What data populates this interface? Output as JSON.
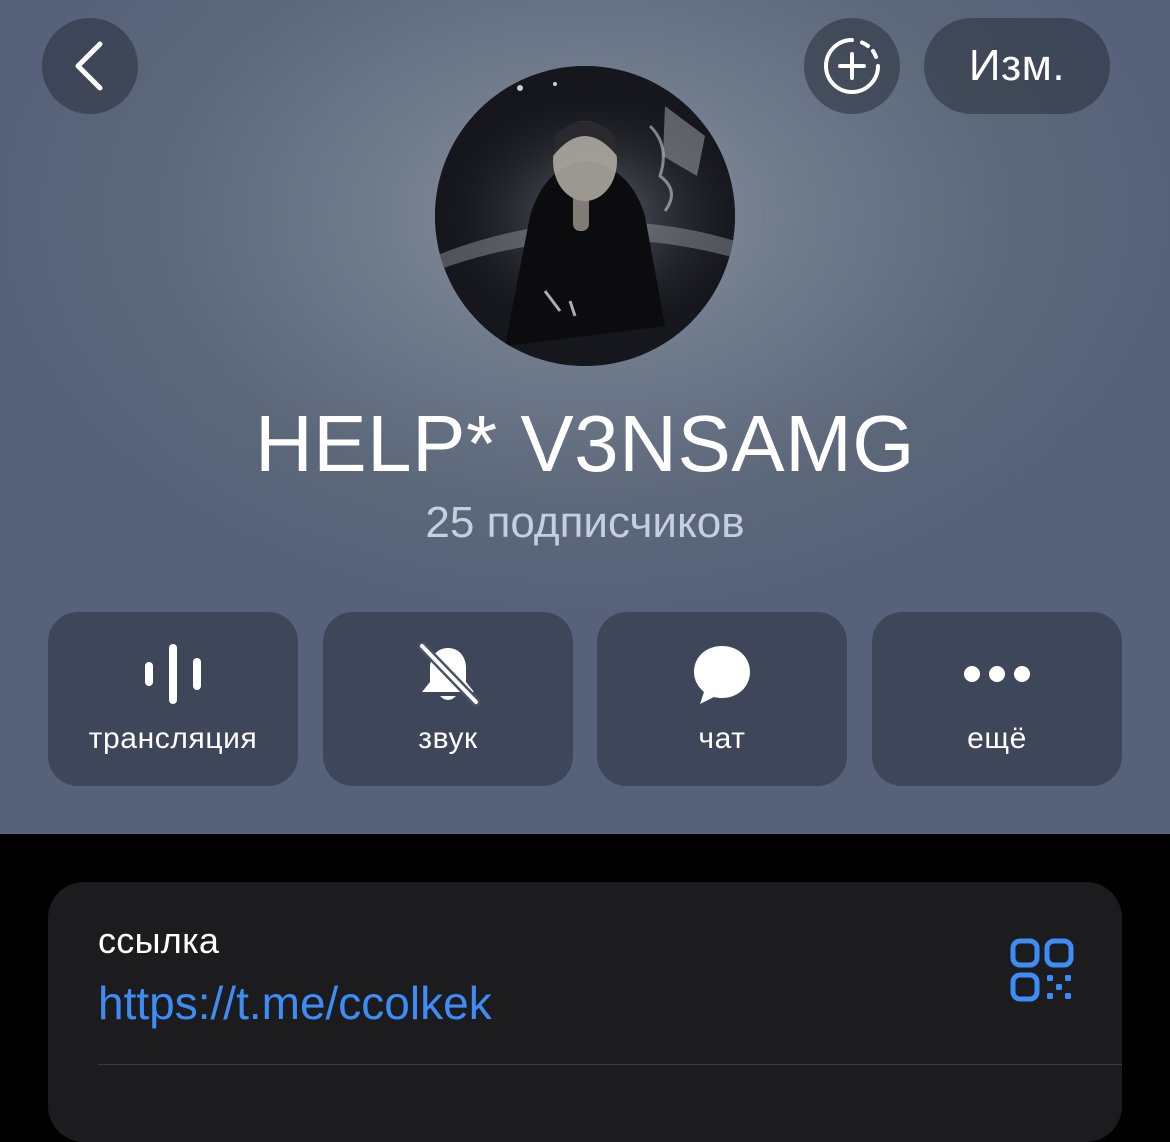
{
  "nav": {
    "edit_label": "Изм."
  },
  "channel": {
    "title": "HELP* V3NSAMG",
    "subscribers": "25 подписчиков"
  },
  "actions": [
    {
      "label": "трансляция",
      "icon": "live-stream-icon"
    },
    {
      "label": "звук",
      "icon": "bell-slash-icon"
    },
    {
      "label": "чат",
      "icon": "chat-bubble-icon"
    },
    {
      "label": "ещё",
      "icon": "more-dots-icon"
    }
  ],
  "info": {
    "link_caption": "ссылка",
    "link_value": "https://t.me/ccolkek"
  },
  "colors": {
    "link": "#3e8cf5",
    "card_bg": "#1c1c1e",
    "subtitle": "#c6cfdf"
  }
}
